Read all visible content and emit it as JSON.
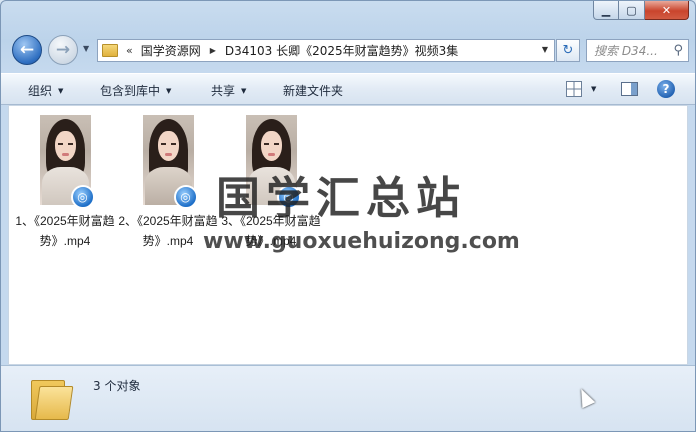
{
  "window": {
    "caption": {
      "minimize": "▁",
      "maximize": "▢",
      "close": "✕"
    }
  },
  "nav": {
    "back_icon": "back-arrow-icon",
    "forward_icon": "forward-arrow-icon",
    "breadcrumb_prefix": "«",
    "breadcrumb": [
      "国学资源网",
      "D34103 长卿《2025年财富趋势》视频3集"
    ],
    "refresh_glyph": "↻",
    "search_placeholder": "搜索 D34..."
  },
  "toolbar": {
    "organize": "组织",
    "include_in_library": "包含到库中",
    "share": "共享",
    "new_folder": "新建文件夹",
    "help": "?"
  },
  "files": [
    {
      "name": "1、《2025年财富趋势》.mp4",
      "badge_glyph": "◎"
    },
    {
      "name": "2、《2025年财富趋势》.mp4",
      "badge_glyph": "◎"
    },
    {
      "name": "3、《2025年财富趋势》.mp4",
      "badge_glyph": "◎"
    }
  ],
  "watermark": {
    "title": "国学汇总站",
    "url": "www.guoxuehuizong.com"
  },
  "details": {
    "count": "3 个对象"
  },
  "colors": {
    "accent": "#2f6fc1",
    "close_button": "#c9452d",
    "folder": "#e6b94b"
  }
}
